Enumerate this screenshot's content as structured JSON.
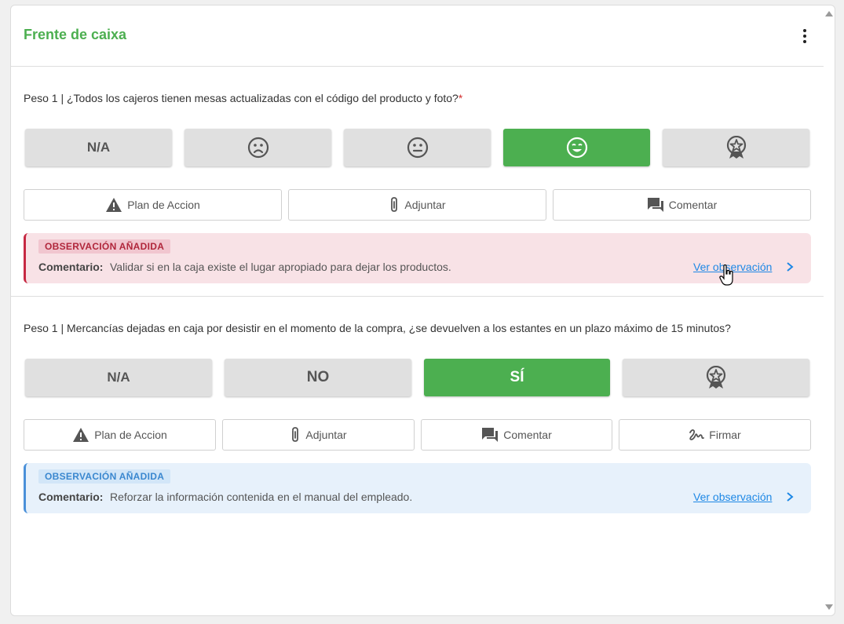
{
  "section": {
    "title": "Frente de caixa",
    "menu_icon": "more-vertical-icon"
  },
  "questions": [
    {
      "text": "Peso 1 | ¿Todos los cajeros tienen mesas actualizadas con el código del producto y foto?",
      "required_mark": "*",
      "options": [
        {
          "label": "N/A",
          "icon": null,
          "selected": false
        },
        {
          "label": "",
          "icon": "sad-face-icon",
          "selected": false
        },
        {
          "label": "",
          "icon": "neutral-face-icon",
          "selected": false
        },
        {
          "label": "",
          "icon": "happy-face-icon",
          "selected": true
        },
        {
          "label": "",
          "icon": "medal-star-icon",
          "selected": false
        }
      ],
      "actions": [
        {
          "label": "Plan de Accion",
          "icon": "warning-icon"
        },
        {
          "label": "Adjuntar",
          "icon": "paperclip-icon"
        },
        {
          "label": "Comentar",
          "icon": "comment-icon"
        }
      ],
      "observation": {
        "badge": "OBSERVACIÓN AÑADIDA",
        "label": "Comentario:",
        "text": "Validar si en la caja existe el lugar apropiado para dejar los productos.",
        "link": "Ver observación",
        "color": "#c62842"
      }
    },
    {
      "text": "Peso 1 | Mercancías dejadas en caja por desistir en el momento de la compra, ¿se devuelven a los estantes en un plazo máximo de 15 minutos?",
      "options": [
        {
          "label": "N/A",
          "icon": null,
          "selected": false
        },
        {
          "label": "NO",
          "icon": null,
          "selected": false
        },
        {
          "label": "SÍ",
          "icon": null,
          "selected": true
        },
        {
          "label": "",
          "icon": "medal-star-icon",
          "selected": false
        }
      ],
      "actions": [
        {
          "label": "Plan de Accion",
          "icon": "warning-icon"
        },
        {
          "label": "Adjuntar",
          "icon": "paperclip-icon"
        },
        {
          "label": "Comentar",
          "icon": "comment-icon"
        },
        {
          "label": "Firmar",
          "icon": "signature-icon"
        }
      ],
      "observation": {
        "badge": "OBSERVACIÓN AÑADIDA",
        "label": "Comentario:",
        "text": "Reforzar la información contenida en el manual del empleado.",
        "link": "Ver observación",
        "color": "#4a90d9"
      }
    }
  ],
  "colors": {
    "accent_green": "#4caf50",
    "link_blue": "#1e88e5"
  }
}
